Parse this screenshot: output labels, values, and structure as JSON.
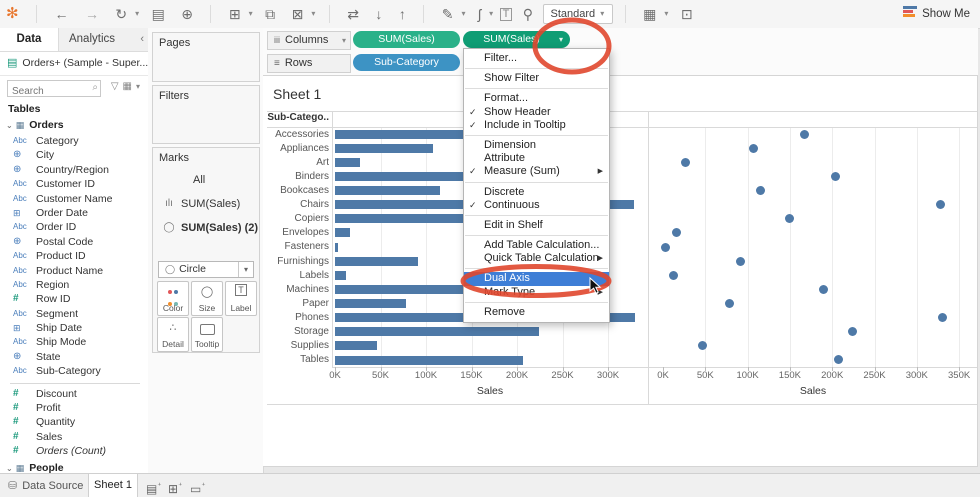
{
  "colors": {
    "bar": "#4e79a7",
    "dot": "#4e79a7",
    "pill_green": "#2ab189",
    "pill_green_selected": "#0f9d74",
    "pill_blue": "#3d93c4",
    "menu_highlight": "#3e7ed6",
    "annotation": "#e0472e",
    "color_btn_dots": [
      "#e15759",
      "#4e79a7",
      "#f28e2b",
      "#76b7b2"
    ]
  },
  "toolbar": {
    "icons": {
      "logo": "✻",
      "back": "←",
      "forward": "→",
      "replay": "↻",
      "save": "▤",
      "add_data": "⊕",
      "new_sheet": "⊞",
      "duplicate": "⧉",
      "clear": "⊠",
      "swap": "⇄",
      "sort_asc": "↓",
      "sort_desc": "↑",
      "highlight": "✎",
      "clip": "ʃ",
      "text_label": "T",
      "pin": "⚲",
      "labels": "▦",
      "presentation": "⊡",
      "caret": "▾"
    },
    "fit_label": "Standard",
    "show_me": "Show Me"
  },
  "sidebar": {
    "tab_data": "Data",
    "tab_analytics": "Analytics",
    "collapse_icon": "‹",
    "datasource": "Orders+ (Sample - Super...",
    "datasource_icon": "▤",
    "search_placeholder": "Search",
    "search_icon": "⌕",
    "funnel_icon": "▽",
    "grid_icon": "▦",
    "caret": "▾",
    "tables_label": "Tables",
    "expander_icon": "⌄",
    "table_icon": "▦",
    "orders_label": "Orders",
    "people_label": "People",
    "fields": [
      {
        "icon": "abc",
        "label": "Category"
      },
      {
        "icon": "geo",
        "label": "City"
      },
      {
        "icon": "geo",
        "label": "Country/Region"
      },
      {
        "icon": "abc",
        "label": "Customer ID"
      },
      {
        "icon": "abc",
        "label": "Customer Name"
      },
      {
        "icon": "cal",
        "label": "Order Date"
      },
      {
        "icon": "abc",
        "label": "Order ID"
      },
      {
        "icon": "geo",
        "label": "Postal Code"
      },
      {
        "icon": "abc",
        "label": "Product ID"
      },
      {
        "icon": "abc",
        "label": "Product Name"
      },
      {
        "icon": "abc",
        "label": "Region"
      },
      {
        "icon": "num",
        "label": "Row ID"
      },
      {
        "icon": "abc",
        "label": "Segment"
      },
      {
        "icon": "cal",
        "label": "Ship Date"
      },
      {
        "icon": "abc",
        "label": "Ship Mode"
      },
      {
        "icon": "geo",
        "label": "State"
      },
      {
        "icon": "abc",
        "label": "Sub-Category"
      },
      {
        "divider": true
      },
      {
        "icon": "num",
        "label": "Discount"
      },
      {
        "icon": "num",
        "label": "Profit"
      },
      {
        "icon": "num",
        "label": "Quantity"
      },
      {
        "icon": "num",
        "label": "Sales"
      },
      {
        "icon": "num",
        "label": "Orders (Count)",
        "italic": true
      }
    ],
    "field_icons": {
      "abc": "Abc",
      "geo": "⊕",
      "cal": "⊞",
      "num": "#"
    }
  },
  "cards": {
    "pages": "Pages",
    "filters": "Filters",
    "marks": {
      "title": "Marks",
      "items": [
        {
          "icon": "",
          "label": "All",
          "indent": true
        },
        {
          "icon": "ılı",
          "label": "SUM(Sales)"
        },
        {
          "icon": "◯",
          "label": "SUM(Sales) (2)",
          "selected": true
        }
      ],
      "mark_type": "Circle",
      "mark_type_icon": "◯",
      "caret": "▾",
      "buttons": [
        {
          "name": "color",
          "label": "Color"
        },
        {
          "name": "size",
          "label": "Size",
          "icon": "◯"
        },
        {
          "name": "label",
          "label": "Label",
          "icon": "T"
        },
        {
          "name": "detail",
          "label": "Detail",
          "icon": "∴"
        },
        {
          "name": "tooltip",
          "label": "Tooltip"
        }
      ]
    }
  },
  "shelves": {
    "columns_label": "Columns",
    "columns_icon": "iii",
    "rows_label": "Rows",
    "rows_icon": "≡",
    "caret": "▾",
    "columns_pills": [
      {
        "label": "SUM(Sales)"
      },
      {
        "label": "SUM(Sales)",
        "selected": true,
        "caret": "▾"
      }
    ],
    "rows_pills": [
      {
        "label": "Sub-Category"
      }
    ]
  },
  "sheet": {
    "title": "Sheet 1",
    "row_header": "Sub-Catego.."
  },
  "chart_data": [
    {
      "type": "bar",
      "title": "Sheet 1",
      "row_header": "Sub-Catego..",
      "categories": [
        "Accessories",
        "Appliances",
        "Art",
        "Binders",
        "Bookcases",
        "Chairs",
        "Copiers",
        "Envelopes",
        "Fasteners",
        "Furnishings",
        "Labels",
        "Machines",
        "Paper",
        "Phones",
        "Storage",
        "Supplies",
        "Tables"
      ],
      "values": [
        167380,
        107532,
        27119,
        203413,
        114880,
        328449,
        149528,
        16476,
        3024,
        91705,
        12486,
        189239,
        78479,
        330007,
        223844,
        46674,
        206966
      ],
      "xlabel": "Sales",
      "xticks": [
        "0K",
        "50K",
        "100K",
        "150K",
        "200K",
        "250K",
        "300K"
      ],
      "xlim": [
        0,
        344000
      ],
      "grid": true
    },
    {
      "type": "scatter",
      "categories": [
        "Accessories",
        "Appliances",
        "Art",
        "Binders",
        "Bookcases",
        "Chairs",
        "Copiers",
        "Envelopes",
        "Fasteners",
        "Furnishings",
        "Labels",
        "Machines",
        "Paper",
        "Phones",
        "Storage",
        "Supplies",
        "Tables"
      ],
      "values": [
        167380,
        107532,
        27119,
        203413,
        114880,
        328449,
        149528,
        16476,
        3024,
        91705,
        12486,
        189239,
        78479,
        330007,
        223844,
        46674,
        206966
      ],
      "xlabel": "Sales",
      "xticks": [
        "0K",
        "50K",
        "100K",
        "150K",
        "200K",
        "250K",
        "300K",
        "350K"
      ],
      "xlim": [
        0,
        372000
      ],
      "grid": true
    }
  ],
  "menu": {
    "check_glyph": "✓",
    "submenu_glyph": "▶",
    "groups": [
      [
        {
          "label": "Filter..."
        }
      ],
      [
        {
          "label": "Show Filter"
        }
      ],
      [
        {
          "label": "Format..."
        },
        {
          "label": "Show Header",
          "checked": true
        },
        {
          "label": "Include in Tooltip",
          "checked": true
        }
      ],
      [
        {
          "label": "Dimension"
        },
        {
          "label": "Attribute"
        },
        {
          "label": "Measure (Sum)",
          "checked": true,
          "submenu": true
        }
      ],
      [
        {
          "label": "Discrete"
        },
        {
          "label": "Continuous",
          "checked": true
        }
      ],
      [
        {
          "label": "Edit in Shelf"
        }
      ],
      [
        {
          "label": "Add Table Calculation..."
        },
        {
          "label": "Quick Table Calculation",
          "submenu": true
        }
      ],
      [
        {
          "label": "Dual Axis",
          "highlighted": true
        },
        {
          "label": "Mark Type",
          "submenu": true
        }
      ],
      [
        {
          "label": "Remove"
        }
      ]
    ]
  },
  "status_bar": {
    "datasource_tab": "Data Source",
    "datasource_icon": "⛁",
    "sheet_tab": "Sheet 1",
    "new_worksheet_icon": "▤",
    "new_dashboard_icon": "⊞",
    "new_story_icon": "▭",
    "plus": "⁺"
  }
}
